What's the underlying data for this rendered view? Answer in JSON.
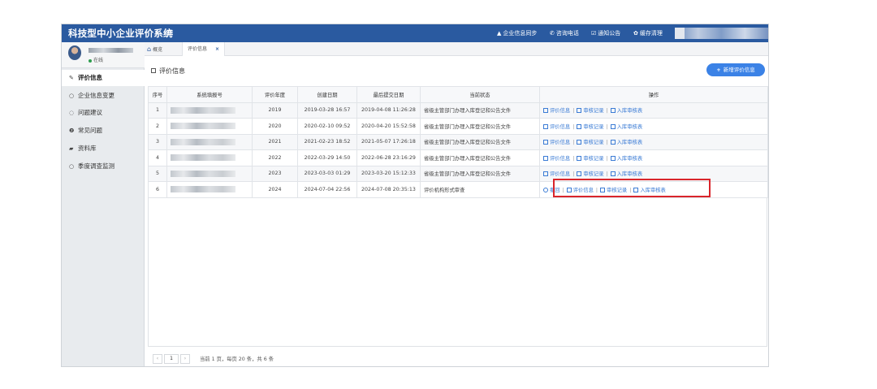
{
  "app": {
    "title": "科技型中小企业评价系统",
    "menu_icon": "≡"
  },
  "topbar": {
    "links": [
      {
        "icon": "user-icon",
        "glyph": "▲",
        "label": "企业信息同步"
      },
      {
        "icon": "phone-icon",
        "glyph": "✆",
        "label": "咨询电话"
      },
      {
        "icon": "notice-icon",
        "glyph": "☑",
        "label": "通知公告"
      },
      {
        "icon": "gear-icon",
        "glyph": "✿",
        "label": "缓存清理"
      }
    ]
  },
  "profile": {
    "status": "在线"
  },
  "sidebar": {
    "items": [
      {
        "icon": "edit-icon",
        "glyph": "✎",
        "label": "评价信息",
        "active": true
      },
      {
        "icon": "circle-icon",
        "glyph": "○",
        "label": "企业信息变更"
      },
      {
        "icon": "comment-icon",
        "glyph": "◌",
        "label": "问题建议"
      },
      {
        "icon": "question-icon",
        "glyph": "❷",
        "label": "常见问题"
      },
      {
        "icon": "folder-icon",
        "glyph": "▰",
        "label": "资料库"
      },
      {
        "icon": "circle-icon",
        "glyph": "○",
        "label": "季度调查监测"
      }
    ]
  },
  "tabs": [
    {
      "icon": "home-icon",
      "glyph": "⌂",
      "label": "概览"
    },
    {
      "label": "评价信息",
      "close": "×"
    }
  ],
  "page": {
    "title": "评价信息",
    "add_button": "新增评价信息",
    "add_glyph": "+"
  },
  "table": {
    "headers": [
      "序号",
      "系统填报号",
      "评价年度",
      "创建日期",
      "最后提交日期",
      "当前状态",
      "操作"
    ],
    "rows": [
      {
        "no": "1",
        "year": "2019",
        "created": "2019-03-28 16:57",
        "submitted": "2019-04-08 11:26:28",
        "status": "省级主管部门办理入库登记和公告文件",
        "actions": [
          "评价信息",
          "审核记录",
          "入库审核表"
        ]
      },
      {
        "no": "2",
        "year": "2020",
        "created": "2020-02-10 09:52",
        "submitted": "2020-04-20 15:52:58",
        "status": "省级主管部门办理入库登记和公告文件",
        "actions": [
          "评价信息",
          "审核记录",
          "入库审核表"
        ]
      },
      {
        "no": "3",
        "year": "2021",
        "created": "2021-02-23 18:52",
        "submitted": "2021-05-07 17:26:18",
        "status": "省级主管部门办理入库登记和公告文件",
        "actions": [
          "评价信息",
          "审核记录",
          "入库审核表"
        ]
      },
      {
        "no": "4",
        "year": "2022",
        "created": "2022-03-29 14:50",
        "submitted": "2022-06-28 23:16:29",
        "status": "省级主管部门办理入库登记和公告文件",
        "actions": [
          "评价信息",
          "审核记录",
          "入库审核表"
        ]
      },
      {
        "no": "5",
        "year": "2023",
        "created": "2023-03-03 01:29",
        "submitted": "2023-03-20 15:12:33",
        "status": "省级主管部门办理入库登记和公告文件",
        "actions": [
          "评价信息",
          "审核记录",
          "入库审核表"
        ]
      },
      {
        "no": "6",
        "year": "2024",
        "created": "2024-07-04 22:56",
        "submitted": "2024-07-08 20:35:13",
        "status": "评价机构形式审查",
        "actions": [
          "撤回",
          "评价信息",
          "审核记录",
          "入库审核表"
        ]
      }
    ]
  },
  "pager": {
    "prev": "‹",
    "current": "1",
    "next": "›",
    "info": "当前 1 页，每页 20 条，共 6 条"
  },
  "colors": {
    "topbar": "#2a5aa0",
    "accent": "#3b82e6",
    "link": "#3a7bd5",
    "highlight": "#d9252b"
  }
}
